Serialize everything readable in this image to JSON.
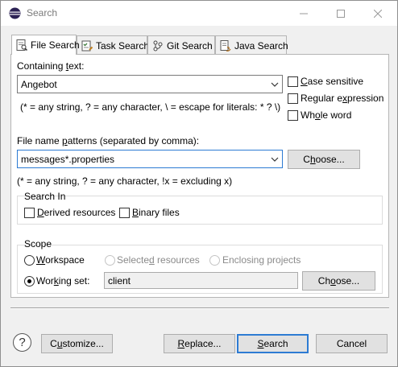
{
  "window": {
    "title": "Search"
  },
  "tabs": [
    {
      "label": "File Search",
      "active": true,
      "icon": "file-search-icon"
    },
    {
      "label": "Task Search",
      "active": false,
      "icon": "task-search-icon"
    },
    {
      "label": "Git Search",
      "active": false,
      "icon": "git-search-icon"
    },
    {
      "label": "Java Search",
      "active": false,
      "icon": "java-search-icon"
    }
  ],
  "containing_text": {
    "label_pre": "Containing ",
    "label_mnemonic": "t",
    "label_post": "ext:",
    "value": "Angebot",
    "hint": "(* = any string, ? = any character, \\ = escape for literals: * ? \\)"
  },
  "options": {
    "case_sensitive": {
      "mnemonic": "C",
      "rest": "ase sensitive",
      "checked": false
    },
    "regular_expression": {
      "pre": "Regular e",
      "mnemonic": "x",
      "post": "pression",
      "checked": false
    },
    "whole_word": {
      "pre": "Wh",
      "mnemonic": "o",
      "post": "le word",
      "checked": false
    }
  },
  "file_patterns": {
    "label_pre": "File name ",
    "label_mnemonic": "p",
    "label_post": "atterns (separated by comma):",
    "value": "messages*.properties",
    "choose_pre": "C",
    "choose_mnemonic": "h",
    "choose_post": "oose...",
    "hint": "(* = any string, ? = any character, !x = excluding x)"
  },
  "search_in": {
    "title": "Search In",
    "derived": {
      "pre": "",
      "mnemonic": "D",
      "post": "erived resources",
      "checked": false
    },
    "binary": {
      "pre": "",
      "mnemonic": "B",
      "post": "inary files",
      "checked": false
    }
  },
  "scope": {
    "title": "Scope",
    "workspace": {
      "pre": "",
      "mnemonic": "W",
      "post": "orkspace",
      "selected": false
    },
    "selected_resources": {
      "pre": "Selecte",
      "mnemonic": "d",
      "post": " resources",
      "enabled": false
    },
    "enclosing_projects": {
      "label": "Enclosing projects",
      "enabled": false
    },
    "working_set": {
      "pre": "Wor",
      "mnemonic": "k",
      "post": "ing set:",
      "selected": true,
      "value": "client"
    },
    "choose_pre": "Ch",
    "choose_mnemonic": "o",
    "choose_post": "ose..."
  },
  "footer": {
    "help_glyph": "?",
    "customize_pre": "C",
    "customize_mnemonic": "u",
    "customize_post": "stomize...",
    "replace_pre": "",
    "replace_mnemonic": "R",
    "replace_post": "eplace...",
    "search_pre": "",
    "search_mnemonic": "S",
    "search_post": "earch",
    "cancel": "Cancel"
  },
  "colors": {
    "accent": "#2d7bd3",
    "dialog_bg": "#f0f0f0",
    "panel_bg": "#ffffff"
  }
}
